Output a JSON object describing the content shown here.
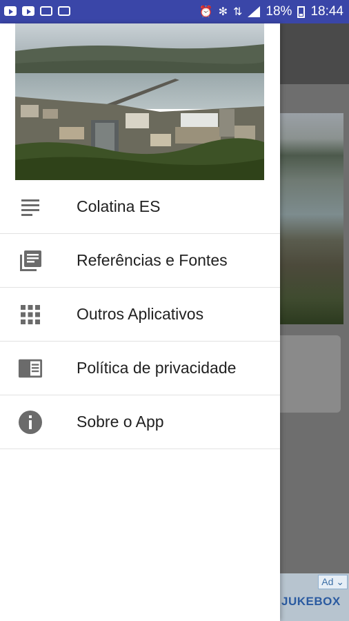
{
  "status_bar": {
    "battery_percent": "18%",
    "time": "18:44",
    "notification_icons": [
      "youtube-icon",
      "youtube-icon",
      "image-icon",
      "gallery-icon"
    ],
    "system_icons": [
      "alarm-icon",
      "wifi-icon",
      "data-icon",
      "signal-icon",
      "battery-icon"
    ]
  },
  "drawer": {
    "header_image": "city-river-bridge-photo",
    "items": [
      {
        "label": "Colatina ES",
        "icon": "notes-icon"
      },
      {
        "label": "Referências e Fontes",
        "icon": "library-books-icon"
      },
      {
        "label": "Outros Aplicativos",
        "icon": "apps-grid-icon"
      },
      {
        "label": "Política de privacidade",
        "icon": "chrome-reader-icon"
      },
      {
        "label": "Sobre o App",
        "icon": "info-icon"
      }
    ]
  },
  "background_ad": {
    "label": "Ad ⌄",
    "brand": "JUKEBOX"
  },
  "colors": {
    "status_bar": "#3a46a8",
    "icon_gray": "#6b6b6b",
    "text": "#212121",
    "divider": "#e2e2e2"
  }
}
